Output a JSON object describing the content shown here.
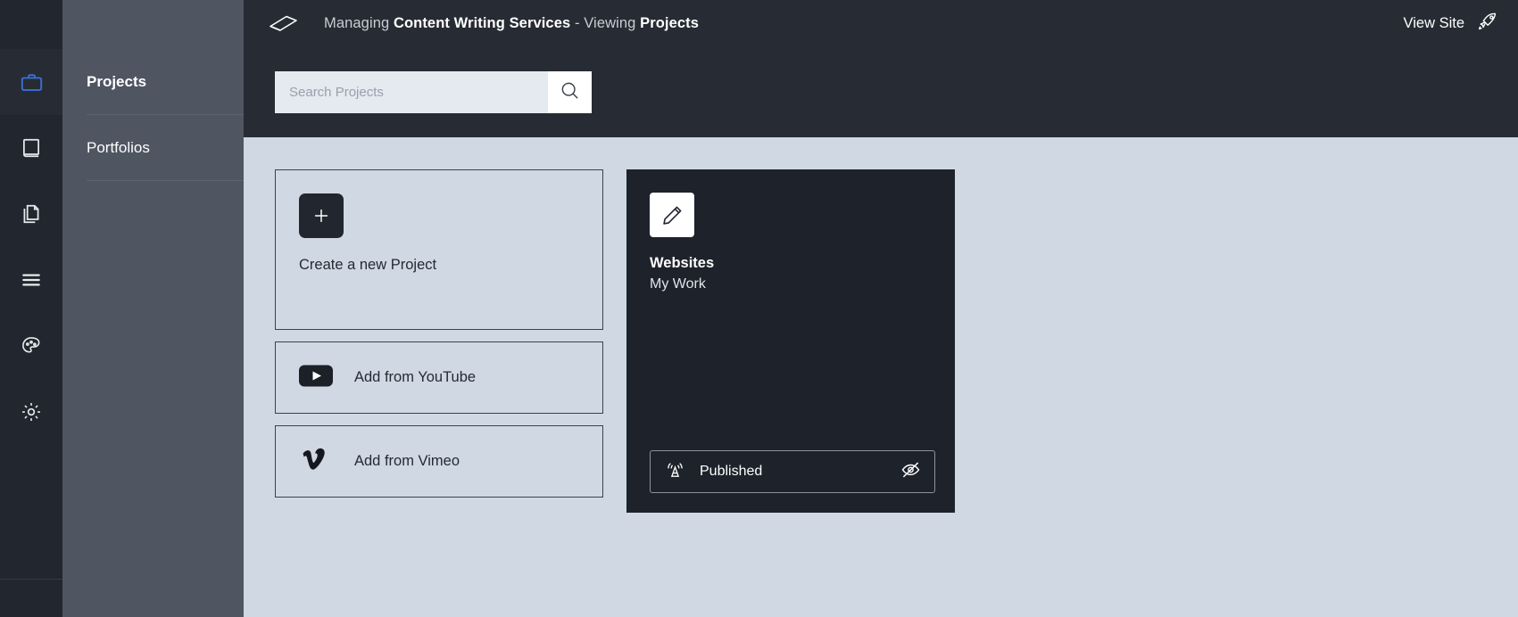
{
  "rail": {
    "items": [
      {
        "icon": "briefcase-icon",
        "active": true
      },
      {
        "icon": "book-icon",
        "active": false
      },
      {
        "icon": "pages-icon",
        "active": false
      },
      {
        "icon": "menu-icon",
        "active": false
      },
      {
        "icon": "palette-icon",
        "active": false
      },
      {
        "icon": "gear-icon",
        "active": false
      }
    ],
    "active_color": "#3b6fd4"
  },
  "sidebar": {
    "items": [
      {
        "label": "Projects"
      },
      {
        "label": "Portfolios"
      }
    ]
  },
  "topbar": {
    "logo_icon": "paper-plane-logo",
    "title_prefix": "Managing ",
    "title_managing": "Content Writing Services",
    "title_separator": " - Viewing ",
    "title_viewing": "Projects",
    "view_site_label": "View Site",
    "view_site_icon": "rocket-icon"
  },
  "search": {
    "placeholder": "Search Projects",
    "value": "",
    "button_icon": "search-icon"
  },
  "actions": {
    "create": {
      "icon": "plus-icon",
      "label": "Create a new Project"
    },
    "sources": [
      {
        "icon": "youtube-icon",
        "label": "Add from YouTube"
      },
      {
        "icon": "vimeo-icon",
        "label": "Add from Vimeo"
      }
    ]
  },
  "project": {
    "icon": "pencil-icon",
    "title": "Websites",
    "subtitle": "My Work",
    "status_label": "Published",
    "status_icon": "broadcast-icon",
    "visibility_icon": "eye-slash-icon"
  }
}
